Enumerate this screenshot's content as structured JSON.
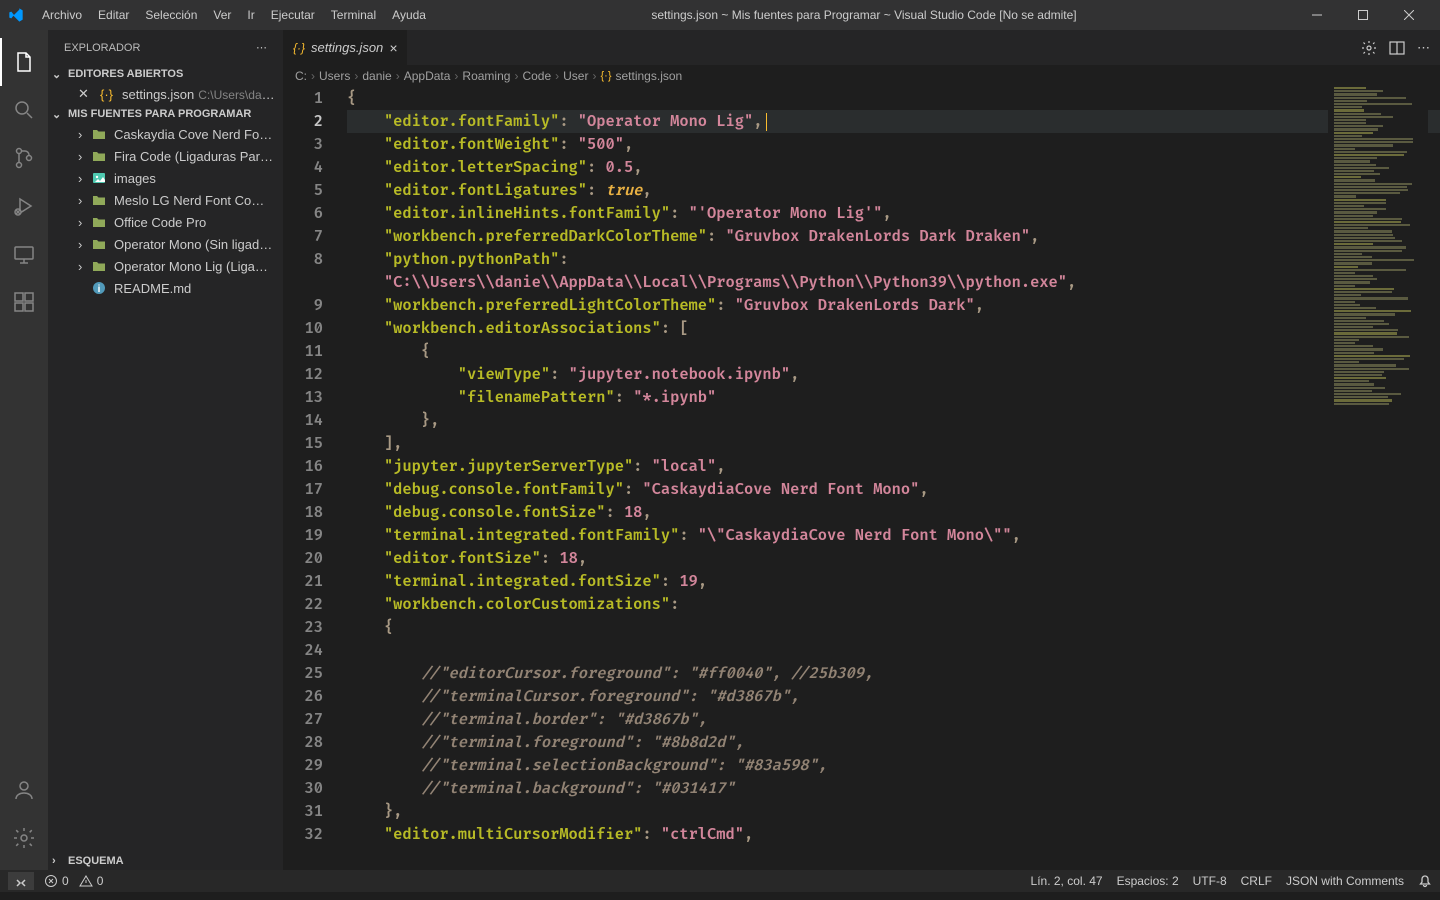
{
  "window": {
    "title": "settings.json ~ Mis fuentes para Programar ~ Visual Studio Code [No se admite]"
  },
  "menu": [
    "Archivo",
    "Editar",
    "Selección",
    "Ver",
    "Ir",
    "Ejecutar",
    "Terminal",
    "Ayuda"
  ],
  "sidebar": {
    "title": "EXPLORADOR",
    "openEditors": "EDITORES ABIERTOS",
    "openFile": "settings.json",
    "openFilePath": "C:\\Users\\danie\\...",
    "project": "MIS FUENTES PARA PROGRAMAR",
    "folders": [
      "Caskaydia Cove Nerd Font (Li...",
      "Fira Code (Ligaduras Para VS ...",
      "images",
      "Meslo LG Nerd Font Complet...",
      "Office Code Pro",
      "Operator Mono (Sin ligaduras)",
      "Operator Mono Lig (Ligadura..."
    ],
    "readme": "README.md",
    "schema": "ESQUEMA"
  },
  "tab": {
    "label": "settings.json"
  },
  "breadcrumb": [
    "C:",
    "Users",
    "danie",
    "AppData",
    "Roaming",
    "Code",
    "User",
    "settings.json"
  ],
  "code": {
    "lines": [
      {
        "n": 1,
        "tokens": [
          {
            "t": "{",
            "c": "p"
          }
        ]
      },
      {
        "n": 2,
        "hl": true,
        "indent": 1,
        "tokens": [
          {
            "t": "\"editor.fontFamily\"",
            "c": "k"
          },
          {
            "t": ": ",
            "c": "p"
          },
          {
            "t": "\"Operator Mono Lig\"",
            "c": "s"
          },
          {
            "t": ",",
            "c": "p"
          },
          {
            "t": "",
            "c": "caret"
          }
        ]
      },
      {
        "n": 3,
        "indent": 1,
        "tokens": [
          {
            "t": "\"editor.fontWeight\"",
            "c": "k"
          },
          {
            "t": ": ",
            "c": "p"
          },
          {
            "t": "\"500\"",
            "c": "s"
          },
          {
            "t": ",",
            "c": "p"
          }
        ]
      },
      {
        "n": 4,
        "indent": 1,
        "tokens": [
          {
            "t": "\"editor.letterSpacing\"",
            "c": "k"
          },
          {
            "t": ": ",
            "c": "p"
          },
          {
            "t": "0.5",
            "c": "n"
          },
          {
            "t": ",",
            "c": "p"
          }
        ]
      },
      {
        "n": 5,
        "indent": 1,
        "tokens": [
          {
            "t": "\"editor.fontLigatures\"",
            "c": "k"
          },
          {
            "t": ": ",
            "c": "p"
          },
          {
            "t": "true",
            "c": "b"
          },
          {
            "t": ",",
            "c": "p"
          }
        ]
      },
      {
        "n": 6,
        "indent": 1,
        "tokens": [
          {
            "t": "\"editor.inlineHints.fontFamily\"",
            "c": "k"
          },
          {
            "t": ": ",
            "c": "p"
          },
          {
            "t": "\"'Operator Mono Lig'\"",
            "c": "s"
          },
          {
            "t": ",",
            "c": "p"
          }
        ]
      },
      {
        "n": 7,
        "indent": 1,
        "tokens": [
          {
            "t": "\"workbench.preferredDarkColorTheme\"",
            "c": "k"
          },
          {
            "t": ": ",
            "c": "p"
          },
          {
            "t": "\"Gruvbox DrakenLords Dark Draken\"",
            "c": "s"
          },
          {
            "t": ",",
            "c": "p"
          }
        ]
      },
      {
        "n": 8,
        "indent": 1,
        "tokens": [
          {
            "t": "\"python.pythonPath\"",
            "c": "k"
          },
          {
            "t": ":",
            "c": "p"
          }
        ]
      },
      {
        "n": 0,
        "indent": 1,
        "tokens": [
          {
            "t": "\"C:\\\\Users\\\\danie\\\\AppData\\\\Local\\\\Programs\\\\Python\\\\Python39\\\\python.exe\"",
            "c": "s"
          },
          {
            "t": ",",
            "c": "p"
          }
        ]
      },
      {
        "n": 9,
        "indent": 1,
        "tokens": [
          {
            "t": "\"workbench.preferredLightColorTheme\"",
            "c": "k"
          },
          {
            "t": ": ",
            "c": "p"
          },
          {
            "t": "\"Gruvbox DrakenLords Dark\"",
            "c": "s"
          },
          {
            "t": ",",
            "c": "p"
          }
        ]
      },
      {
        "n": 10,
        "indent": 1,
        "tokens": [
          {
            "t": "\"workbench.editorAssociations\"",
            "c": "k"
          },
          {
            "t": ": [",
            "c": "p"
          }
        ]
      },
      {
        "n": 11,
        "indent": 2,
        "tokens": [
          {
            "t": "{",
            "c": "p"
          }
        ]
      },
      {
        "n": 12,
        "indent": 3,
        "tokens": [
          {
            "t": "\"viewType\"",
            "c": "k"
          },
          {
            "t": ": ",
            "c": "p"
          },
          {
            "t": "\"jupyter.notebook.ipynb\"",
            "c": "s"
          },
          {
            "t": ",",
            "c": "p"
          }
        ]
      },
      {
        "n": 13,
        "indent": 3,
        "tokens": [
          {
            "t": "\"filenamePattern\"",
            "c": "k"
          },
          {
            "t": ": ",
            "c": "p"
          },
          {
            "t": "\"*.ipynb\"",
            "c": "s"
          }
        ]
      },
      {
        "n": 14,
        "indent": 2,
        "tokens": [
          {
            "t": "},",
            "c": "p"
          }
        ]
      },
      {
        "n": 15,
        "indent": 1,
        "tokens": [
          {
            "t": "],",
            "c": "p"
          }
        ]
      },
      {
        "n": 16,
        "indent": 1,
        "tokens": [
          {
            "t": "\"jupyter.jupyterServerType\"",
            "c": "k"
          },
          {
            "t": ": ",
            "c": "p"
          },
          {
            "t": "\"local\"",
            "c": "s"
          },
          {
            "t": ",",
            "c": "p"
          }
        ]
      },
      {
        "n": 17,
        "indent": 1,
        "tokens": [
          {
            "t": "\"debug.console.fontFamily\"",
            "c": "k"
          },
          {
            "t": ": ",
            "c": "p"
          },
          {
            "t": "\"CaskaydiaCove Nerd Font Mono\"",
            "c": "s"
          },
          {
            "t": ",",
            "c": "p"
          }
        ]
      },
      {
        "n": 18,
        "indent": 1,
        "tokens": [
          {
            "t": "\"debug.console.fontSize\"",
            "c": "k"
          },
          {
            "t": ": ",
            "c": "p"
          },
          {
            "t": "18",
            "c": "n"
          },
          {
            "t": ",",
            "c": "p"
          }
        ]
      },
      {
        "n": 19,
        "indent": 1,
        "tokens": [
          {
            "t": "\"terminal.integrated.fontFamily\"",
            "c": "k"
          },
          {
            "t": ": ",
            "c": "p"
          },
          {
            "t": "\"\\\"CaskaydiaCove Nerd Font Mono\\\"\"",
            "c": "s"
          },
          {
            "t": ",",
            "c": "p"
          }
        ]
      },
      {
        "n": 20,
        "indent": 1,
        "tokens": [
          {
            "t": "\"editor.fontSize\"",
            "c": "k"
          },
          {
            "t": ": ",
            "c": "p"
          },
          {
            "t": "18",
            "c": "n"
          },
          {
            "t": ",",
            "c": "p"
          }
        ]
      },
      {
        "n": 21,
        "indent": 1,
        "tokens": [
          {
            "t": "\"terminal.integrated.fontSize\"",
            "c": "k"
          },
          {
            "t": ": ",
            "c": "p"
          },
          {
            "t": "19",
            "c": "n"
          },
          {
            "t": ",",
            "c": "p"
          }
        ]
      },
      {
        "n": 22,
        "indent": 1,
        "tokens": [
          {
            "t": "\"workbench.colorCustomizations\"",
            "c": "k"
          },
          {
            "t": ":",
            "c": "p"
          }
        ]
      },
      {
        "n": 23,
        "indent": 1,
        "tokens": [
          {
            "t": "{",
            "c": "p"
          }
        ]
      },
      {
        "n": 24,
        "indent": 1,
        "tokens": []
      },
      {
        "n": 25,
        "indent": 2,
        "tokens": [
          {
            "t": "//\"editorCursor.foreground\": \"#ff0040\", //25b309,",
            "c": "c"
          }
        ]
      },
      {
        "n": 26,
        "indent": 2,
        "tokens": [
          {
            "t": "//\"terminalCursor.foreground\": \"#d3867b\",",
            "c": "c"
          }
        ]
      },
      {
        "n": 27,
        "indent": 2,
        "tokens": [
          {
            "t": "//\"terminal.border\": \"#d3867b\",",
            "c": "c"
          }
        ]
      },
      {
        "n": 28,
        "indent": 2,
        "tokens": [
          {
            "t": "//\"terminal.foreground\": \"#8b8d2d\",",
            "c": "c"
          }
        ]
      },
      {
        "n": 29,
        "indent": 2,
        "tokens": [
          {
            "t": "//\"terminal.selectionBackground\": \"#83a598\",",
            "c": "c"
          }
        ]
      },
      {
        "n": 30,
        "indent": 2,
        "tokens": [
          {
            "t": "//\"terminal.background\": \"#031417\"",
            "c": "c"
          }
        ]
      },
      {
        "n": 31,
        "indent": 1,
        "tokens": [
          {
            "t": "},",
            "c": "p"
          }
        ]
      },
      {
        "n": 32,
        "indent": 1,
        "tokens": [
          {
            "t": "\"editor.multiCursorModifier\"",
            "c": "k"
          },
          {
            "t": ": ",
            "c": "p"
          },
          {
            "t": "\"ctrlCmd\"",
            "c": "s"
          },
          {
            "t": ",",
            "c": "p"
          }
        ]
      }
    ]
  },
  "status": {
    "errors": "0",
    "warnings": "0",
    "lncol": "Lín. 2, col. 47",
    "spaces": "Espacios: 2",
    "encoding": "UTF-8",
    "eol": "CRLF",
    "lang": "JSON with Comments"
  }
}
